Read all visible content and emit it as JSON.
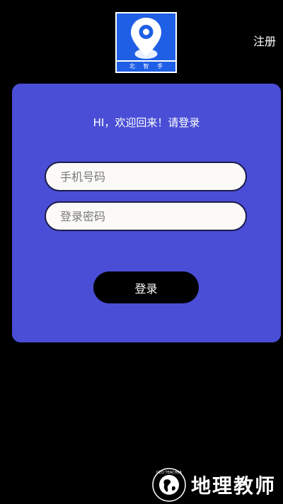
{
  "app": {
    "logo_text": [
      "北",
      "智",
      "手"
    ],
    "register_label": "注册"
  },
  "login": {
    "greeting": "HI，欢迎回来！请登录",
    "phone_placeholder": "手机号码",
    "password_placeholder": "登录密码",
    "submit_label": "登录"
  },
  "watermark": {
    "text": "地理教师",
    "seal_text": "GEO TEACHER"
  },
  "colors": {
    "background": "#000000",
    "card": "#4a4ed6",
    "logo_blue": "#1f5fe6",
    "field_bg": "#fbfaf7",
    "button_bg": "#000000"
  }
}
